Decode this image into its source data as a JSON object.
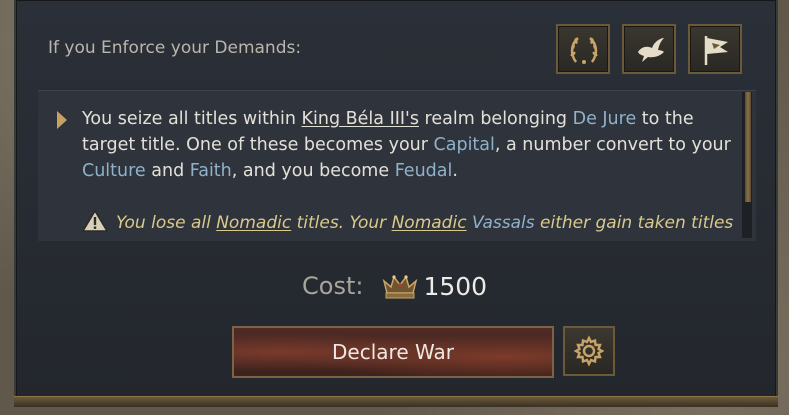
{
  "header": {
    "title": "If you Enforce your Demands:"
  },
  "icons": {
    "laurel": "laurel-wreath-icon",
    "dove": "dove-icon",
    "flag": "war-banner-icon",
    "warning": "warning-triangle-icon",
    "crown": "crown-icon",
    "settings": "gear-icon"
  },
  "description": {
    "t1": "You seize all titles within ",
    "ruler": "King Béla III's",
    "t2": " realm belonging ",
    "dejure": "De Jure",
    "t3": " to the target title. One of these becomes your ",
    "capital": "Capital",
    "t4": ", a number convert to your ",
    "culture": "Culture",
    "t5": " and ",
    "faith": "Faith",
    "t6": ", and you become ",
    "feudal": "Feudal",
    "t7": "."
  },
  "warning": {
    "t1": "You lose all ",
    "nomadic1": "Nomadic",
    "t2": " titles. Your ",
    "nomadic2": "Nomadic",
    "t3": " ",
    "vassals": "Vassals",
    "t4": " either gain taken titles"
  },
  "cost": {
    "label": "Cost:",
    "value": "1500"
  },
  "actions": {
    "declare_label": "Declare War"
  },
  "colors": {
    "keyword": "#8fb1c9",
    "warning_text": "#d9c98b",
    "accent_gold": "#c7a062"
  }
}
